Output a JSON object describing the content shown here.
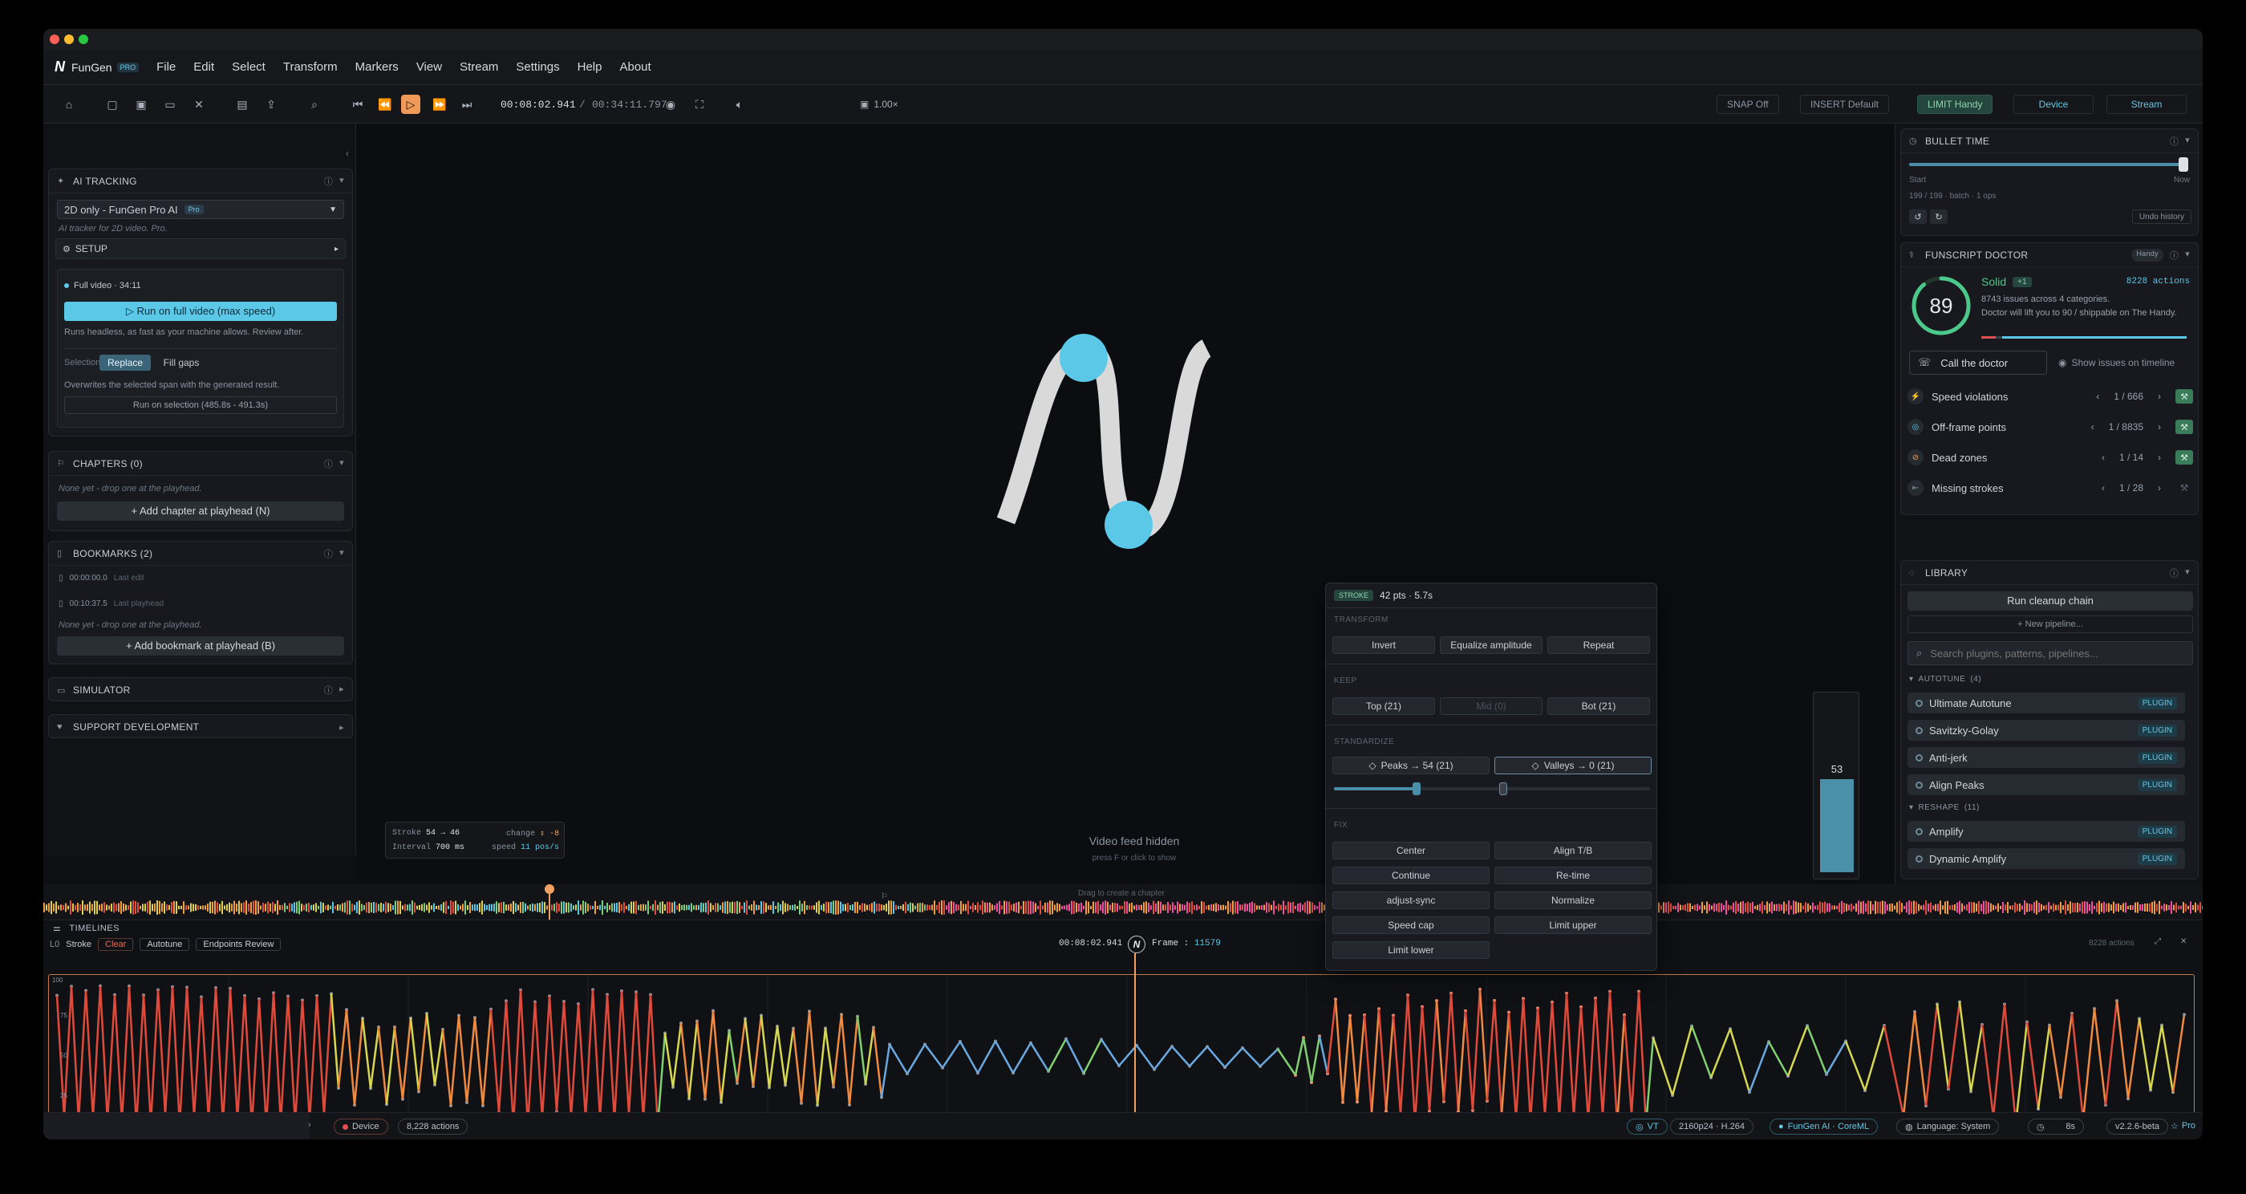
{
  "app": {
    "title": "FunGen",
    "badge": "PRO"
  },
  "menu": [
    "File",
    "Edit",
    "Select",
    "Transform",
    "Markers",
    "View",
    "Stream",
    "Settings",
    "Help",
    "About"
  ],
  "toolbar": {
    "time_current": "00:08:02.941",
    "time_total": "00:34:11.797",
    "speed": "1.00×",
    "snap": "SNAP  Off",
    "insert": "INSERT  Default",
    "limit": "LIMIT  Handy",
    "device": "Device",
    "stream": "Stream"
  },
  "ai_tracking": {
    "header": "AI TRACKING",
    "model": "2D only - FunGen Pro AI",
    "model_badge": "Pro",
    "desc": "AI tracker for 2D video. Pro.",
    "setup": "SETUP",
    "scope": "Full video · 34:11",
    "run_full": "▷  Run on full video (max speed)",
    "run_desc": "Runs headless, as fast as your machine allows. Review after.",
    "selection_label": "Selection",
    "replace": "Replace",
    "fill_gaps": "Fill gaps",
    "overwrite_desc": "Overwrites the selected span with the generated result.",
    "run_selection": "Run on selection (485.8s - 491.3s)"
  },
  "chapters": {
    "header": "CHAPTERS (0)",
    "empty": "None yet - drop one at the playhead.",
    "add": "+ Add chapter at playhead  (N)"
  },
  "bookmarks": {
    "header": "BOOKMARKS (2)",
    "items": [
      {
        "time": "00:00:00.0",
        "note": "Last edit"
      },
      {
        "time": "00:10:37.5",
        "note": "Last playhead"
      }
    ],
    "empty": "None yet - drop one at the playhead.",
    "add": "+ Add bookmark at playhead  (B)"
  },
  "simulator": {
    "header": "SIMULATOR"
  },
  "support": {
    "header": "SUPPORT DEVELOPMENT"
  },
  "video": {
    "hidden": "Video feed hidden",
    "hint": "press F or click to show",
    "stroke_label": "Stroke",
    "stroke_value": "54 → 46",
    "change_label": "change",
    "change_value": "-8",
    "interval_label": "Interval",
    "interval_value": "700 ms",
    "speed_label": "speed",
    "speed_value": "11 pos/s",
    "meter_value": "53",
    "meter_level": 0.53,
    "chapter_hint": "Drag to create a chapter"
  },
  "popup": {
    "badge": "STROKE",
    "summary": "42 pts · 5.7s",
    "transform_title": "TRANSFORM",
    "transform": [
      "Invert",
      "Equalize amplitude",
      "Repeat"
    ],
    "keep_title": "KEEP",
    "keep": [
      "Top (21)",
      "Mid (0)",
      "Bot (21)"
    ],
    "standardize_title": "STANDARDIZE",
    "peaks": "Peaks → 54 (21)",
    "valleys": "Valleys → 0 (21)",
    "fix_title": "FIX",
    "fix": [
      "Center",
      "Align T/B",
      "Continue",
      "Re-time",
      "adjust-sync",
      "Normalize",
      "Speed cap",
      "Limit upper",
      "Limit lower"
    ]
  },
  "bullet_time": {
    "header": "BULLET TIME",
    "start": "Start",
    "end": "Now",
    "info": "199 / 199 · batch · 1 ops",
    "undo": "Undo history"
  },
  "doctor": {
    "header": "FUNSCRIPT DOCTOR",
    "device_badge": "Handy",
    "score": "89",
    "score_fraction": 0.89,
    "grade": "Solid",
    "delta": "+1",
    "actions": "8228 actions",
    "issues_summary": "8743 issues across 4 categories.",
    "lift_text": "Doctor will lift you to 90 / shippable on The Handy.",
    "call": "Call the doctor",
    "show_issues": "Show issues on timeline",
    "issues": [
      {
        "label": "Speed violations",
        "pos": "1",
        "total": "666"
      },
      {
        "label": "Off-frame points",
        "pos": "1",
        "total": "8835"
      },
      {
        "label": "Dead zones",
        "pos": "1",
        "total": "14"
      },
      {
        "label": "Missing strokes",
        "pos": "1",
        "total": "28"
      }
    ]
  },
  "library": {
    "header": "LIBRARY",
    "run_chain": "Run cleanup chain",
    "new_pipeline": "+ New pipeline...",
    "search_placeholder": "Search plugins, patterns, pipelines...",
    "groups": [
      {
        "name": "AUTOTUNE",
        "count": "(4)",
        "items": [
          "Ultimate Autotune",
          "Savitzky-Golay",
          "Anti-jerk",
          "Align Peaks"
        ]
      },
      {
        "name": "RESHAPE",
        "count": "(11)",
        "items": [
          "Amplify",
          "Dynamic Amplify"
        ]
      }
    ],
    "tag": "PLUGIN"
  },
  "timelines": {
    "header": "TIMELINES",
    "track_id": "L0",
    "track_name": "Stroke",
    "clear": "Clear",
    "autotune": "Autotune",
    "review": "Endpoints Review",
    "time": "00:08:02.941",
    "frame_label": "Frame :",
    "frame": "11579",
    "actions": "8228 actions",
    "y_ticks": [
      "100",
      "75",
      "50",
      "25",
      "0"
    ]
  },
  "status": {
    "device": "Device",
    "actions": "8,228 actions",
    "vt": "VT",
    "codec": "2160p24 · H.264",
    "ai": "FunGen AI · CoreML",
    "language": "Language: System",
    "timer": "8s",
    "version": "v2.2.6-beta",
    "pro": "Pro"
  },
  "colors": {
    "accent": "#5bc8e8",
    "orange": "#f0a060",
    "green": "#4cc98a",
    "red": "#e05050"
  }
}
